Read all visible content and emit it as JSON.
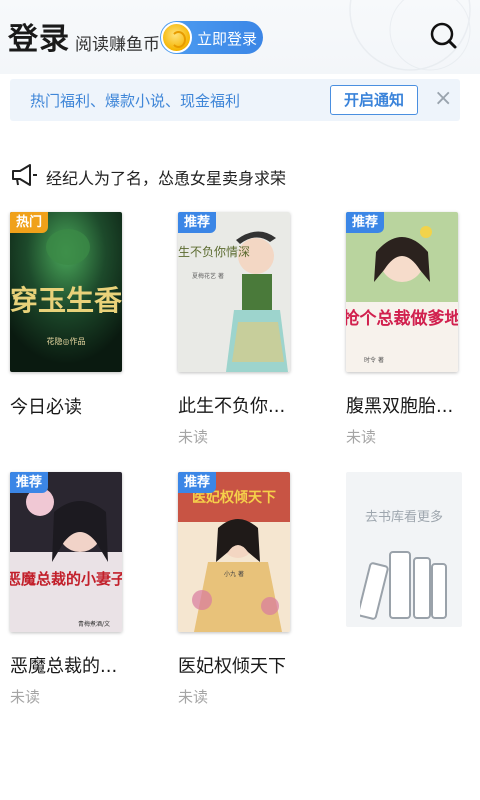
{
  "header": {
    "login_title": "登录",
    "login_sub": "阅读赚鱼币",
    "login_button": "立即登录",
    "search_icon": "search-icon"
  },
  "notice": {
    "text": "热门福利、爆款小说、现金福利",
    "button": "开启通知",
    "close": "×"
  },
  "announcement": {
    "icon": "megaphone-icon",
    "text": "经纪人为了名，怂恿女星卖身求荣"
  },
  "books": [
    {
      "badge": "热门",
      "badge_type": "hot",
      "title": "今日必读",
      "status": "",
      "cover_text": "穿玉生香",
      "cover_author": "花隐◎作品"
    },
    {
      "badge": "推荐",
      "badge_type": "rec",
      "title": "此生不负你...",
      "status": "未读",
      "cover_text": "此生不负你情深",
      "cover_author": "夏梅花艺 著"
    },
    {
      "badge": "推荐",
      "badge_type": "rec",
      "title": "腹黑双胞胎...",
      "status": "未读",
      "cover_text": "抢个总裁做爹地",
      "cover_author": "时令 著"
    },
    {
      "badge": "推荐",
      "badge_type": "rec",
      "title": "恶魔总裁的...",
      "status": "未读",
      "cover_text": "恶魔总裁的小妻子",
      "cover_author": "青梅煮酒/文"
    },
    {
      "badge": "推荐",
      "badge_type": "rec",
      "title": "医妃权倾天下",
      "status": "未读",
      "cover_text": "医妃权倾天下",
      "cover_author": "小九 著"
    }
  ],
  "more": {
    "text": "去书库看更多",
    "icon": "bookshelf-icon"
  },
  "colors": {
    "accent": "#3b86e6",
    "hot": "#f0a11a",
    "muted": "#a5a5a5"
  }
}
